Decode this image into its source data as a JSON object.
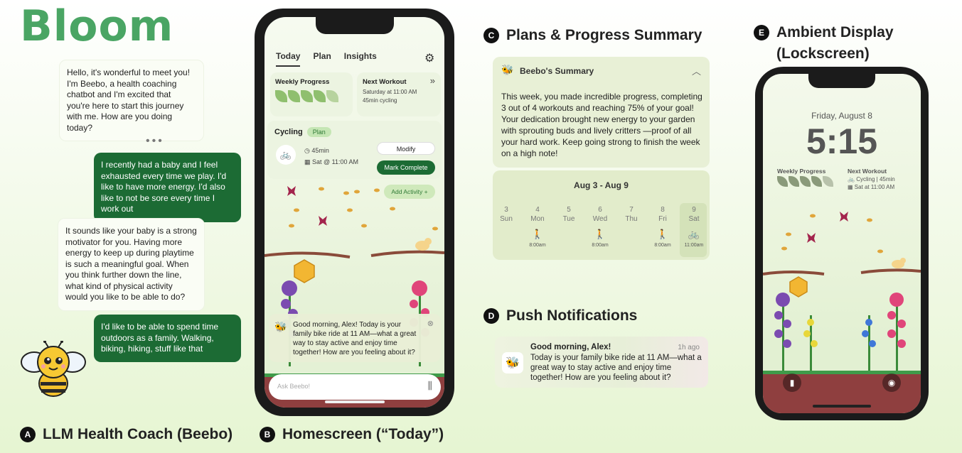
{
  "app_title": "Bloom",
  "chat": {
    "m1": "Hello, it's wonderful to meet you! I'm Beebo, a health coaching chatbot and I'm excited that you're here to start this journey with me. How are you doing today?",
    "dots": "•••",
    "m2": "I recently had a baby and I feel exhausted every time we play. I'd like to have more energy. I'd also like to not be sore every time I work out",
    "m3": "It sounds like your baby is a strong motivator for you. Having more energy to keep up during playtime is such a meaningful goal. When you think further down the line, what kind of physical activity would you like to be able to do?",
    "m4": "I'd like to be able to spend time outdoors as a family. Walking, biking, hiking, stuff like that"
  },
  "captions": {
    "a_letter": "A",
    "a": "LLM Health Coach (Beebo)",
    "b_letter": "B",
    "b": "Homescreen (“Today”)",
    "c_letter": "C",
    "c": "Plans & Progress Summary",
    "d_letter": "D",
    "d": "Push Notifications",
    "e_letter": "E",
    "e1": "Ambient Display",
    "e2": "(Lockscreen)"
  },
  "home": {
    "tabs": [
      "Today",
      "Plan",
      "Insights"
    ],
    "weekly_progress": "Weekly Progress",
    "next_workout": "Next Workout",
    "next_workout_time": "Saturday at 11:00 AM",
    "next_workout_detail": "45min cycling",
    "activity": "Cycling",
    "activity_tag": "Plan",
    "duration": "45min",
    "when": "Sat @ 11:00 AM",
    "modify": "Modify",
    "mark_complete": "Mark Complete",
    "add_activity": "Add Activity +",
    "notification": "Good morning, Alex! Today is your family bike ride at 11 AM—what a great way to stay active and enjoy time together! How are you feeling about it?",
    "ask_placeholder": "Ask Beebo!"
  },
  "summary": {
    "title": "Beebo's Summary",
    "body": "This week, you made incredible progress, completing 3 out of 4 workouts and reaching 75% of your goal! Your dedication brought new energy to your garden with sprouting buds and lively critters —proof of all your hard work. Keep going strong to finish the week on a high note!",
    "range": "Aug 3 - Aug 9",
    "days": [
      {
        "num": "3",
        "name": "Sun",
        "time": ""
      },
      {
        "num": "4",
        "name": "Mon",
        "time": "8:00am"
      },
      {
        "num": "5",
        "name": "Tue",
        "time": ""
      },
      {
        "num": "6",
        "name": "Wed",
        "time": "8:00am"
      },
      {
        "num": "7",
        "name": "Thu",
        "time": ""
      },
      {
        "num": "8",
        "name": "Fri",
        "time": "8:00am"
      },
      {
        "num": "9",
        "name": "Sat",
        "time": "11:00am"
      }
    ]
  },
  "push": {
    "title": "Good morning, Alex!",
    "ago": "1h ago",
    "body": "Today is your family bike ride at 11 AM—what a great way to stay active and enjoy time together! How are you feeling about it?"
  },
  "lock": {
    "date": "Friday, August 8",
    "time": "5:15",
    "weekly_progress": "Weekly Progress",
    "next_workout": "Next Workout",
    "next_detail": "Cycling | 45min",
    "next_time": "Sat at 11:00 AM"
  },
  "colors": {
    "brand": "#4aa564",
    "dark_green": "#1c6b34",
    "soil": "#8f3f3f"
  }
}
